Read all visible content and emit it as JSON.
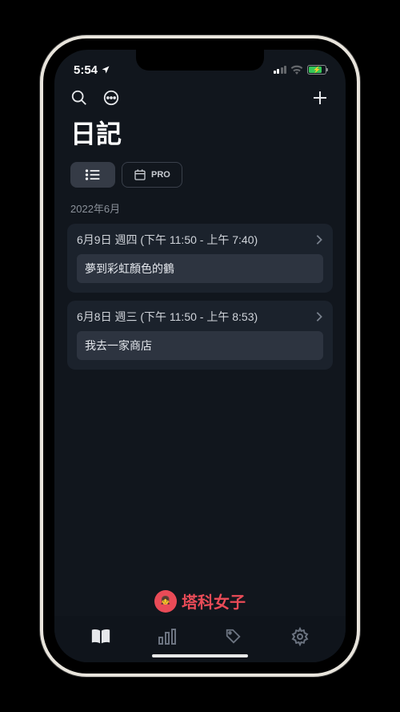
{
  "status": {
    "time": "5:54",
    "location_icon": true
  },
  "toolbar": {
    "add_label": "+"
  },
  "page": {
    "title": "日記"
  },
  "segmented": {
    "pro_label": "PRO"
  },
  "month": "2022年6月",
  "entries": [
    {
      "date": "6月9日 週四 (下午 11:50 - 上午 7:40)",
      "text": "夢到彩虹顏色的鶴"
    },
    {
      "date": "6月8日 週三 (下午 11:50 - 上午 8:53)",
      "text": "我去一家商店"
    }
  ],
  "watermark": "塔科女子"
}
